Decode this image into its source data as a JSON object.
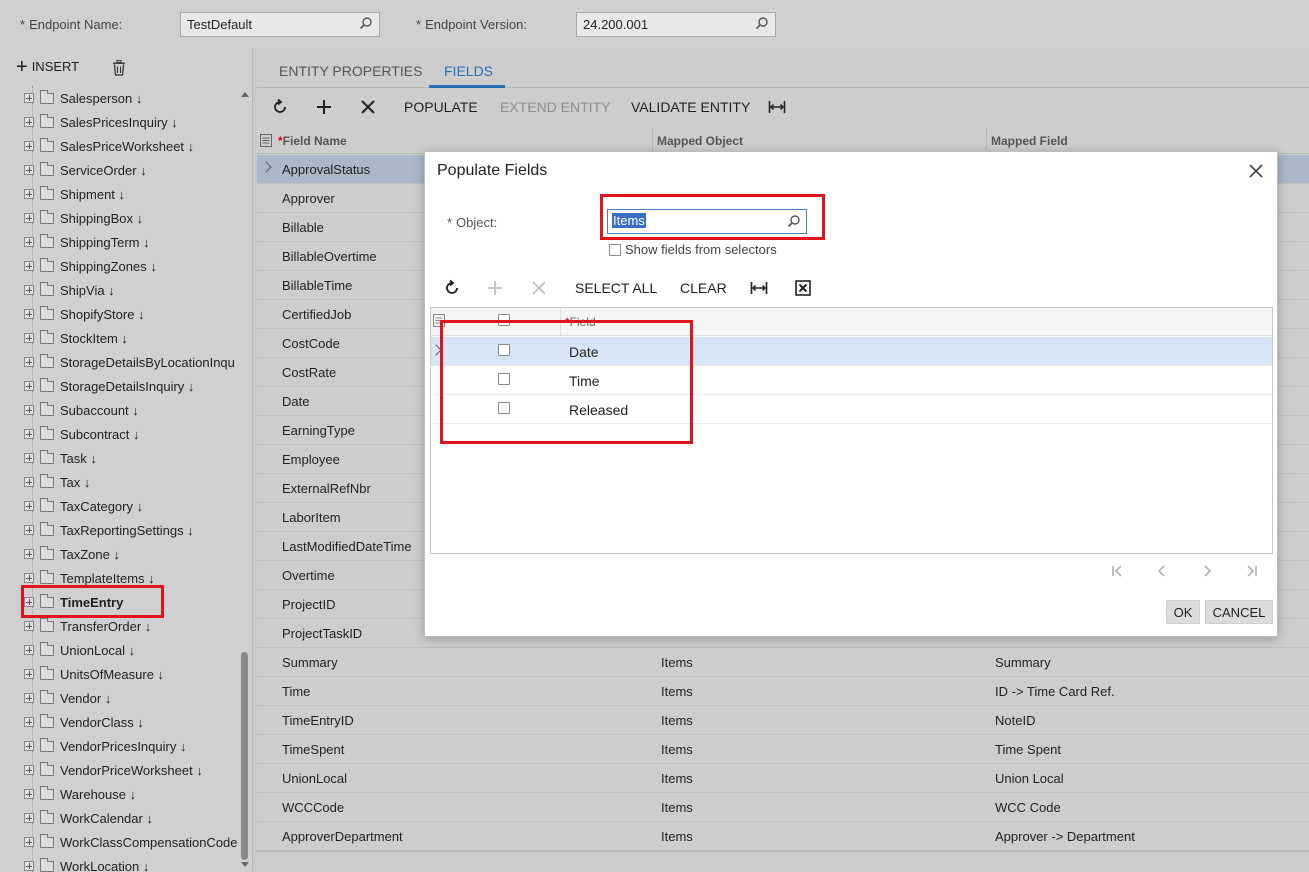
{
  "header": {
    "endpoint_name_label": "Endpoint Name:",
    "endpoint_name_value": "TestDefault",
    "endpoint_version_label": "Endpoint Version:",
    "endpoint_version_value": "24.200.001",
    "required_marker": "*"
  },
  "tree_toolbar": {
    "insert_label": "INSERT"
  },
  "tree": {
    "items": [
      "Salesperson ↓",
      "SalesPricesInquiry ↓",
      "SalesPriceWorksheet ↓",
      "ServiceOrder ↓",
      "Shipment ↓",
      "ShippingBox ↓",
      "ShippingTerm ↓",
      "ShippingZones ↓",
      "ShipVia ↓",
      "ShopifyStore ↓",
      "StockItem ↓",
      "StorageDetailsByLocationInqu",
      "StorageDetailsInquiry ↓",
      "Subaccount ↓",
      "Subcontract ↓",
      "Task ↓",
      "Tax ↓",
      "TaxCategory ↓",
      "TaxReportingSettings ↓",
      "TaxZone ↓",
      "TemplateItems ↓",
      "TimeEntry",
      "TransferOrder ↓",
      "UnionLocal ↓",
      "UnitsOfMeasure ↓",
      "Vendor ↓",
      "VendorClass ↓",
      "VendorPricesInquiry ↓",
      "VendorPriceWorksheet ↓",
      "Warehouse ↓",
      "WorkCalendar ↓",
      "WorkClassCompensationCode",
      "WorkLocation ↓"
    ],
    "selected": "TimeEntry"
  },
  "tabs": {
    "entity_properties": "ENTITY PROPERTIES",
    "fields": "FIELDS",
    "active": "FIELDS"
  },
  "toolbar": {
    "populate": "POPULATE",
    "extend_entity": "EXTEND ENTITY",
    "validate_entity": "VALIDATE ENTITY"
  },
  "grid": {
    "columns": {
      "field_name": "Field Name",
      "mapped_object": "Mapped Object",
      "mapped_field": "Mapped Field"
    },
    "rows": [
      [
        "ApprovalStatus",
        "",
        ""
      ],
      [
        "Approver",
        "",
        ""
      ],
      [
        "Billable",
        "",
        ""
      ],
      [
        "BillableOvertime",
        "",
        ""
      ],
      [
        "BillableTime",
        "",
        ""
      ],
      [
        "CertifiedJob",
        "",
        ""
      ],
      [
        "CostCode",
        "",
        ""
      ],
      [
        "CostRate",
        "",
        ""
      ],
      [
        "Date",
        "",
        ""
      ],
      [
        "EarningType",
        "",
        ""
      ],
      [
        "Employee",
        "",
        ""
      ],
      [
        "ExternalRefNbr",
        "",
        ""
      ],
      [
        "LaborItem",
        "",
        ""
      ],
      [
        "LastModifiedDateTime",
        "",
        ""
      ],
      [
        "Overtime",
        "",
        ""
      ],
      [
        "ProjectID",
        "",
        ""
      ],
      [
        "ProjectTaskID",
        "",
        ""
      ],
      [
        "Summary",
        "Items",
        "Summary"
      ],
      [
        "Time",
        "Items",
        "ID -> Time Card Ref."
      ],
      [
        "TimeEntryID",
        "Items",
        "NoteID"
      ],
      [
        "TimeSpent",
        "Items",
        "Time Spent"
      ],
      [
        "UnionLocal",
        "Items",
        "Union Local"
      ],
      [
        "WCCCode",
        "Items",
        "WCC Code"
      ],
      [
        "ApproverDepartment",
        "Items",
        "Approver -> Department"
      ]
    ]
  },
  "modal": {
    "title": "Populate Fields",
    "object_label": "Object:",
    "object_value": "Items",
    "show_fields_label": "Show fields from selectors",
    "select_all": "SELECT ALL",
    "clear": "CLEAR",
    "field_header": "Field",
    "rows": [
      "Date",
      "Time",
      "Released"
    ],
    "ok": "OK",
    "cancel": "CANCEL"
  },
  "colors": {
    "accent": "#2a6fb5",
    "highlight_box": "#e0141c",
    "selected_row": "#aab8c8"
  }
}
